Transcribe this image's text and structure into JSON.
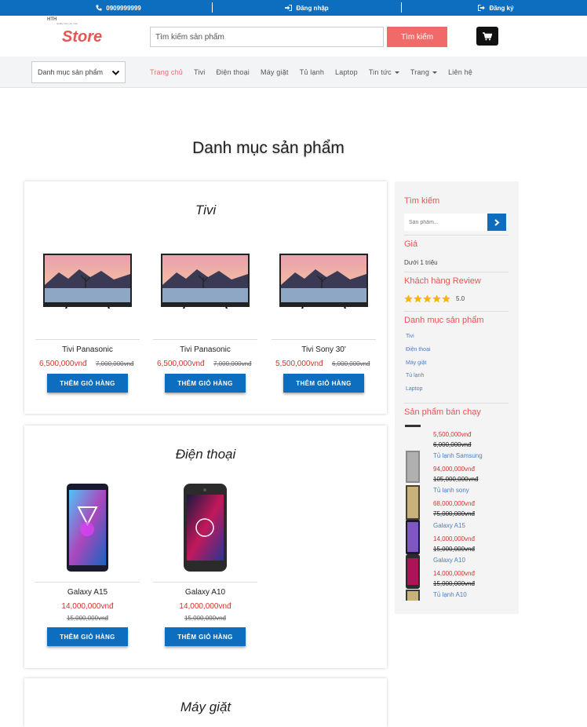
{
  "topbar": {
    "phone": "0909999999",
    "login": "Đăng nhập",
    "register": "Đăng ký"
  },
  "header": {
    "logo_small": "HTH",
    "logo_tagline": "quality that you trust",
    "logo_text": "Store",
    "search_placeholder": "Tìm kiếm sản phẩm",
    "search_button": "Tìm kiếm"
  },
  "nav": {
    "category_select": "Danh mục sản phẩm",
    "links": [
      "Trang chủ",
      "Tivi",
      "Điện thoại",
      "Máy giặt",
      "Tủ lạnh",
      "Laptop",
      "Tin tức",
      "Trang",
      "Liên hệ"
    ]
  },
  "page_title": "Danh mục sản phẩm",
  "sections": [
    {
      "title": "Tivi",
      "products": [
        {
          "name": "Tivi Panasonic",
          "price": "6,500,000vnđ",
          "old_price": "7,000,000vnđ",
          "button": "THÊM GIỎ HÀNG"
        },
        {
          "name": "Tivi Panasonic",
          "price": "6,500,000vnđ",
          "old_price": "7,000,000vnđ",
          "button": "THÊM GIỎ HÀNG"
        },
        {
          "name": "Tivi Sony 30'",
          "price": "5,500,000vnđ",
          "old_price": "6,000,000vnđ",
          "button": "THÊM GIỎ HÀNG"
        }
      ]
    },
    {
      "title": "Điện thoại",
      "products": [
        {
          "name": "Galaxy A15",
          "price": "14,000,000vnđ",
          "old_price": "15,000,000vnđ",
          "button": "THÊM GIỎ HÀNG"
        },
        {
          "name": "Galaxy A10",
          "price": "14,000,000vnđ",
          "old_price": "15,000,000vnđ",
          "button": "THÊM GIỎ HÀNG"
        }
      ]
    },
    {
      "title": "Máy giặt",
      "products": []
    }
  ],
  "sidebar": {
    "search_title": "Tìm kiếm",
    "search_placeholder": "Sản phẩm...",
    "price_title": "Giá",
    "price_option": "Dưới 1 triệu",
    "review_title": "Khách hàng Review",
    "rating": "5.0",
    "category_title": "Danh mục sản phẩm",
    "categories": [
      "Tivi",
      "Điện thoại",
      "Máy giặt",
      "Tủ lạnh",
      "Laptop"
    ],
    "bestseller_title": "Sản phẩm bán chạy",
    "bestsellers": [
      {
        "price": "5,500,000vnđ",
        "old_price": "6,000,000vnđ",
        "name": "Tủ lạnh Samsung"
      },
      {
        "price": "94,000,000vnđ",
        "old_price": "105,000,000vnđ",
        "name": "Tủ lạnh sony"
      },
      {
        "price": "68,000,000vnđ",
        "old_price": "75,000,000vnđ",
        "name": "Galaxy A15"
      },
      {
        "price": "14,000,000vnđ",
        "old_price": "15,000,000vnđ",
        "name": "Galaxy A10"
      },
      {
        "price": "14,000,000vnđ",
        "old_price": "15,000,000vnđ",
        "name": "Tủ lạnh A10"
      }
    ]
  },
  "colors": {
    "primary": "#0d6ebf",
    "accent": "#f06a6a",
    "price": "#d9322f"
  }
}
